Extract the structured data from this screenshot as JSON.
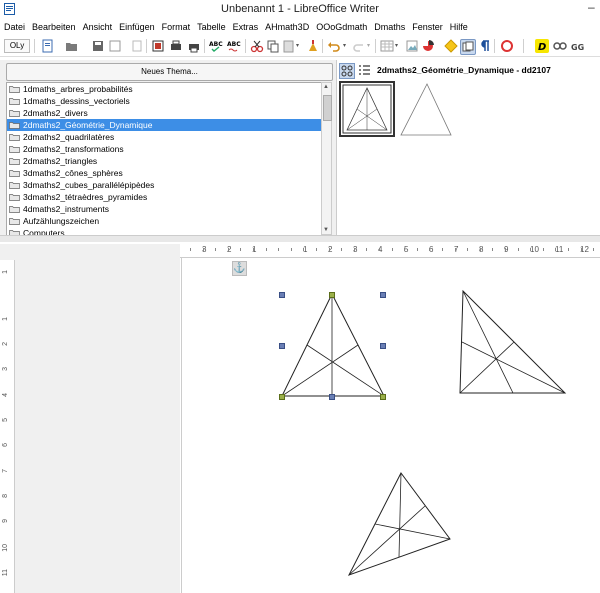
{
  "window": {
    "title": "Unbenannt 1 - LibreOffice Writer",
    "minimize_glyph": "–"
  },
  "menu": [
    "Datei",
    "Bearbeiten",
    "Ansicht",
    "Einfügen",
    "Format",
    "Tabelle",
    "Extras",
    "AHmath3D",
    "OOoGdmath",
    "Dmaths",
    "Fenster",
    "Hilfe"
  ],
  "toolbar": {
    "style_box": "OLy",
    "icons": [
      "new-document-icon",
      "open-icon",
      "save-icon",
      "export-icon",
      "print-icon",
      "pdf-icon",
      "print-preview-icon",
      "spellcheck-icon",
      "autospell-icon",
      "cut-icon",
      "copy-icon",
      "paste-icon",
      "clone-format-icon",
      "undo-icon",
      "redo-icon",
      "table-icon",
      "image-icon",
      "chart-icon",
      "gallery-icon",
      "navigator-icon",
      "formatting-marks-icon",
      "help-icon",
      "dmaths-icon",
      "link-icon",
      "oogdmath-icon"
    ]
  },
  "gallery": {
    "new_theme_label": "Neues Thema...",
    "themes": [
      "1dmaths_arbres_probabilités",
      "1dmaths_dessins_vectoriels",
      "2dmaths2_divers",
      "2dmaths2_Géométrie_Dynamique",
      "2dmaths2_quadrilatères",
      "2dmaths2_transformations",
      "2dmaths2_triangles",
      "3dmaths2_cônes_sphères",
      "3dmaths2_cubes_parallélépipèdes",
      "3dmaths2_tétraèdres_pyramides",
      "4dmaths2_instruments",
      "Aufzählungszeichen",
      "Computers"
    ],
    "selected_index": 3,
    "preview_title": "2dmaths2_Géométrie_Dynamique - dd2107"
  },
  "ruler": {
    "horizontal": [
      "3",
      "2",
      "1",
      "1",
      "2",
      "3",
      "4",
      "5",
      "6",
      "7",
      "8",
      "9",
      "10",
      "11",
      "12"
    ],
    "vertical": [
      "1",
      "1",
      "2",
      "3",
      "4",
      "5",
      "6",
      "7",
      "8",
      "9",
      "10",
      "11"
    ]
  },
  "colors": {
    "selection": "#3d8ee6",
    "handle": "#6a7fb5",
    "handle_green": "#9bb04a"
  }
}
